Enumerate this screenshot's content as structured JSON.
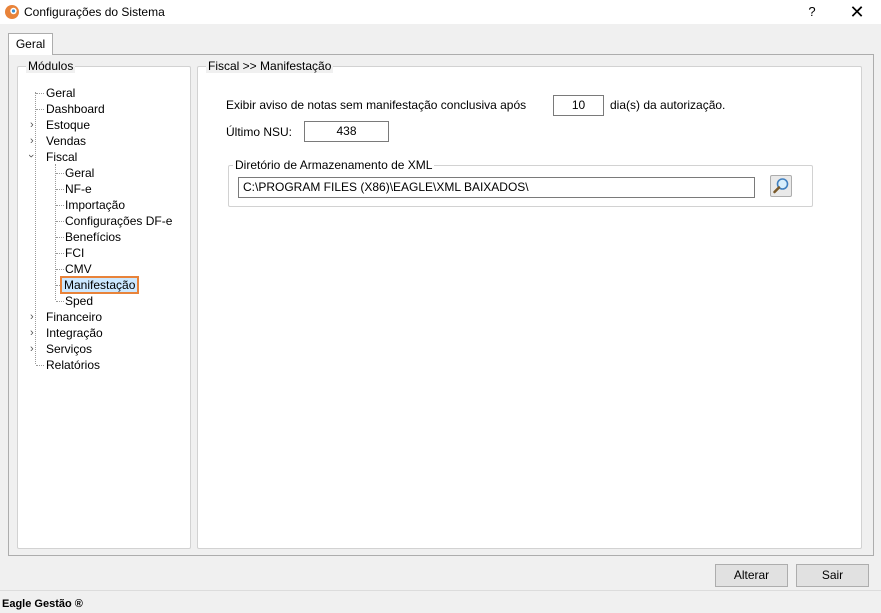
{
  "window": {
    "title": "Configurações do Sistema",
    "help": "?",
    "close": "✕"
  },
  "tabs": [
    {
      "label": "Geral",
      "active": true
    }
  ],
  "modules": {
    "label": "Módulos",
    "tree": [
      {
        "label": "Geral",
        "level": 0
      },
      {
        "label": "Dashboard",
        "level": 0
      },
      {
        "label": "Estoque",
        "level": 0,
        "expandable": true
      },
      {
        "label": "Vendas",
        "level": 0,
        "expandable": true
      },
      {
        "label": "Fiscal",
        "level": 0,
        "expanded": true
      },
      {
        "label": "Geral",
        "level": 1
      },
      {
        "label": "NF-e",
        "level": 1
      },
      {
        "label": "Importação",
        "level": 1
      },
      {
        "label": "Configurações DF-e",
        "level": 1
      },
      {
        "label": "Benefícios",
        "level": 1
      },
      {
        "label": "FCI",
        "level": 1
      },
      {
        "label": "CMV",
        "level": 1
      },
      {
        "label": "Manifestação",
        "level": 1,
        "selected": true
      },
      {
        "label": "Sped",
        "level": 1
      },
      {
        "label": "Financeiro",
        "level": 0,
        "expandable": true
      },
      {
        "label": "Integração",
        "level": 0,
        "expandable": true
      },
      {
        "label": "Serviços",
        "level": 0,
        "expandable": true
      },
      {
        "label": "Relatórios",
        "level": 0
      }
    ]
  },
  "content": {
    "section_title": "Fiscal >> Manifestação",
    "aviso_label": "Exibir aviso de notas sem manifestação conclusiva após",
    "aviso_value": "10",
    "aviso_suffix": "dia(s) da autorização.",
    "nsu_label": "Último NSU:",
    "nsu_value": "438",
    "xml_group_label": "Diretório de Armazenamento de XML",
    "xml_path": "C:\\PROGRAM FILES (X86)\\EAGLE\\XML BAIXADOS\\"
  },
  "buttons": {
    "alterar": "Alterar",
    "sair": "Sair"
  },
  "status": {
    "text": "Eagle Gestão ®"
  },
  "colors": {
    "selection_border": "#e8833a",
    "selection_fill": "#cce8ff"
  }
}
